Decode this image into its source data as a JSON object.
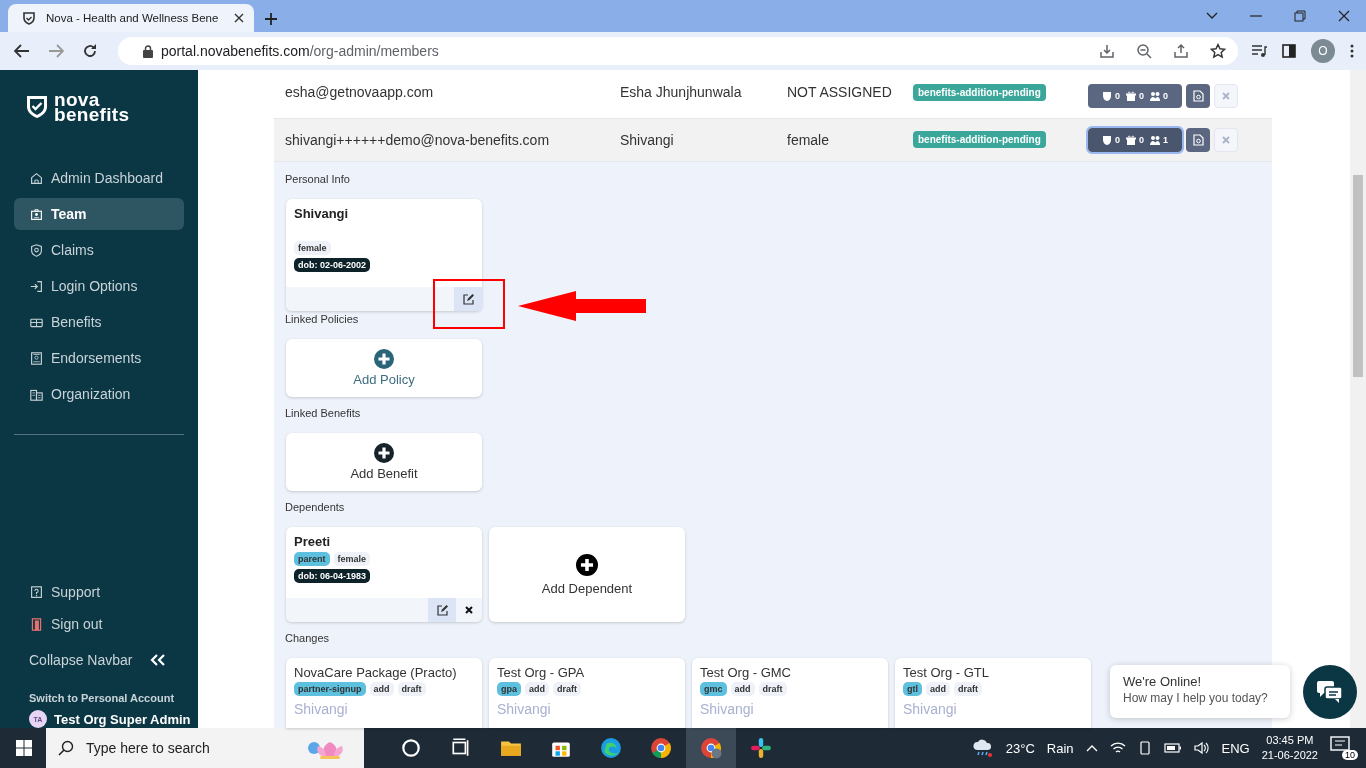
{
  "browser": {
    "tab_title": "Nova - Health and Wellness Bene",
    "url_host": "portal.novabenefits.com",
    "url_path": "/org-admin/members",
    "profile_initial": "O"
  },
  "sidebar": {
    "logo": [
      "nova",
      "benefits"
    ],
    "nav": [
      {
        "label": "Admin Dashboard",
        "selected": false
      },
      {
        "label": "Team",
        "selected": true
      },
      {
        "label": "Claims",
        "selected": false
      },
      {
        "label": "Login Options",
        "selected": false
      },
      {
        "label": "Benefits",
        "selected": false
      },
      {
        "label": "Endorsements",
        "selected": false
      },
      {
        "label": "Organization",
        "selected": false
      }
    ],
    "footer_links": [
      {
        "label": "Support"
      },
      {
        "label": "Sign out"
      }
    ],
    "collapse_label": "Collapse Navbar",
    "switch_label": "Switch to Personal Account",
    "user_initials": "TA",
    "user_name": "Test Org Super Admin"
  },
  "members": [
    {
      "email": "esha@getnovaapp.com",
      "name": "Esha Jhunjhunwala",
      "gender": "NOT ASSIGNED",
      "status": "benefits-addition-pending",
      "counts": [
        "0",
        "0",
        "0"
      ],
      "expanded": false
    },
    {
      "email": "shivangi++++++demo@nova-benefits.com",
      "name": "Shivangi",
      "gender": "female",
      "status": "benefits-addition-pending",
      "counts": [
        "0",
        "0",
        "1"
      ],
      "expanded": true
    }
  ],
  "details": {
    "personal_info": {
      "heading": "Personal Info",
      "card": {
        "name": "Shivangi",
        "tags": [
          {
            "text": "female",
            "kind": "plain"
          }
        ],
        "dob": "dob: 02-06-2002"
      }
    },
    "linked_policies": {
      "heading": "Linked Policies",
      "add_label": "Add Policy"
    },
    "linked_benefits": {
      "heading": "Linked Benefits",
      "add_label": "Add Benefit"
    },
    "dependents": {
      "heading": "Dependents",
      "items": [
        {
          "name": "Preeti",
          "tags": [
            {
              "text": "parent",
              "kind": "highlight"
            },
            {
              "text": "female",
              "kind": "plain"
            }
          ],
          "dob": "dob: 06-04-1983"
        }
      ],
      "add_label": "Add Dependent"
    },
    "changes": {
      "heading": "Changes",
      "items": [
        {
          "title": "NovaCare Package (Practo)",
          "tags": [
            {
              "text": "partner-signup",
              "kind": "highlight"
            },
            {
              "text": "add",
              "kind": "plain"
            },
            {
              "text": "draft",
              "kind": "plain"
            }
          ],
          "member": "Shivangi"
        },
        {
          "title": "Test Org - GPA",
          "tags": [
            {
              "text": "gpa",
              "kind": "highlight"
            },
            {
              "text": "add",
              "kind": "plain"
            },
            {
              "text": "draft",
              "kind": "plain"
            }
          ],
          "member": "Shivangi"
        },
        {
          "title": "Test Org - GMC",
          "tags": [
            {
              "text": "gmc",
              "kind": "highlight"
            },
            {
              "text": "add",
              "kind": "plain"
            },
            {
              "text": "draft",
              "kind": "plain"
            }
          ],
          "member": "Shivangi"
        },
        {
          "title": "Test Org - GTL",
          "tags": [
            {
              "text": "gtl",
              "kind": "highlight"
            },
            {
              "text": "add",
              "kind": "plain"
            },
            {
              "text": "draft",
              "kind": "plain"
            }
          ],
          "member": "Shivangi"
        }
      ]
    }
  },
  "chat": {
    "title": "We're Online!",
    "subtitle": "How may I help you today?"
  },
  "taskbar": {
    "search_placeholder": "Type here to search",
    "temperature": "23°C",
    "weather": "Rain",
    "language": "ENG",
    "time": "03:45 PM",
    "date": "21-06-2022",
    "notification_count": "10"
  }
}
